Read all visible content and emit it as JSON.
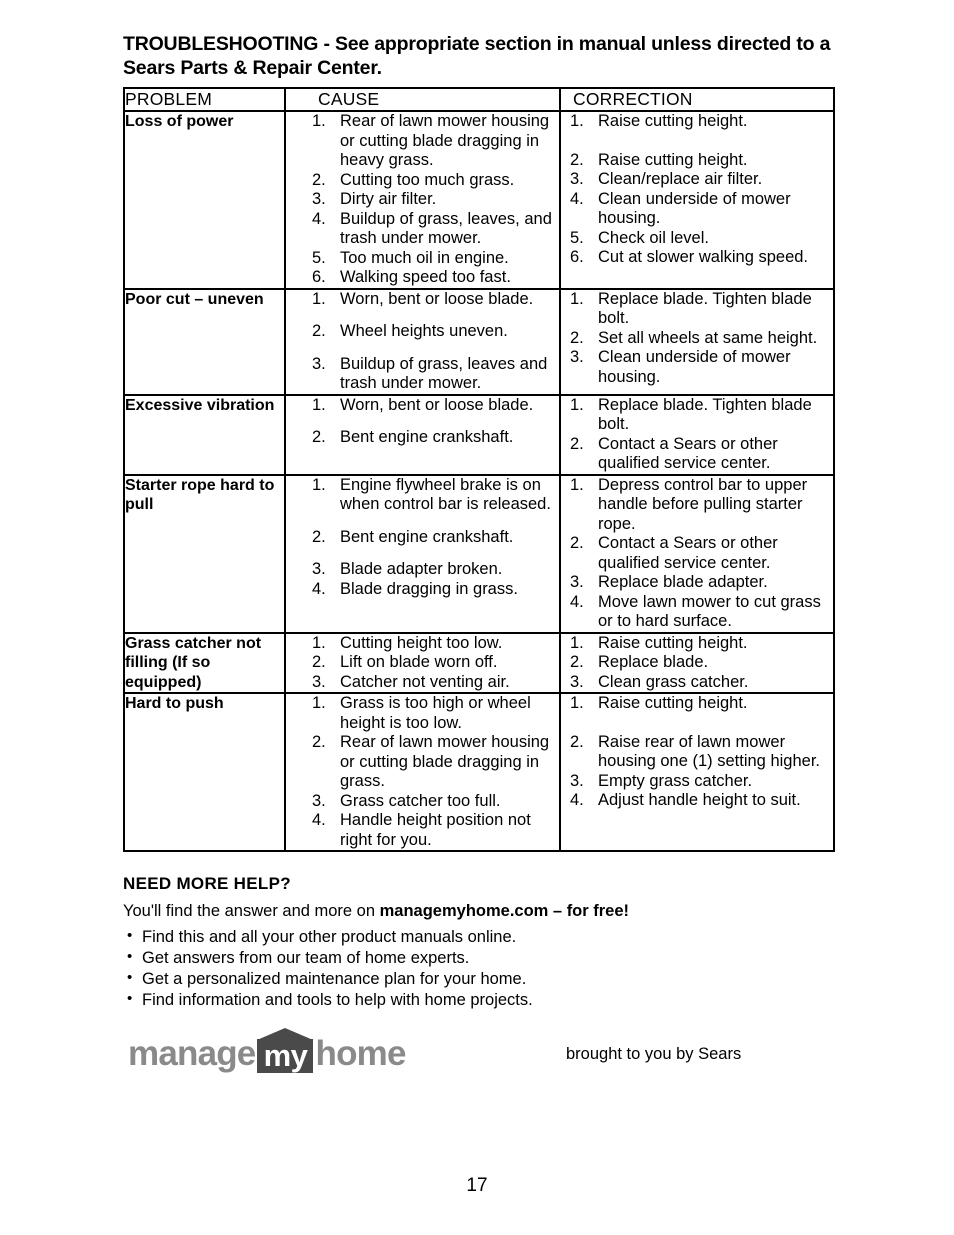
{
  "document": {
    "heading": "TROUBLESHOOTING - See appropriate section in manual unless directed to a Sears Parts & Repair Center.",
    "page_number": "17"
  },
  "table": {
    "headers": {
      "problem": "PROBLEM",
      "cause": "CAUSE",
      "correction": "CORRECTION"
    },
    "rows": [
      {
        "problem": "Loss of power",
        "causes": [
          "Rear of lawn mower housing or cutting blade dragging in heavy grass.",
          "Cutting too much grass.",
          "Dirty air filter.",
          "Buildup of grass, leaves, and trash under mower.",
          "Too much oil in engine.",
          "Walking speed too fast."
        ],
        "corrections": [
          "Raise cutting height.",
          "Raise cutting height.",
          "Clean/replace air filter.",
          "Clean underside of mower housing.",
          "Check oil level.",
          "Cut at slower walking speed."
        ]
      },
      {
        "problem": "Poor cut – uneven",
        "causes": [
          "Worn, bent or loose blade.",
          "Wheel heights uneven.",
          "Buildup of grass, leaves and trash under mower."
        ],
        "corrections": [
          "Replace blade. Tighten blade bolt.",
          "Set all wheels at same height.",
          "Clean underside of mower housing."
        ]
      },
      {
        "problem": "Excessive vibration",
        "causes": [
          "Worn, bent or loose blade.",
          "Bent engine crankshaft."
        ],
        "corrections": [
          "Replace blade. Tighten blade bolt.",
          "Contact a Sears or other qualified service center."
        ]
      },
      {
        "problem": "Starter rope hard to pull",
        "causes": [
          "Engine flywheel brake is on when control bar is released.",
          "Bent engine crankshaft.",
          "Blade adapter broken.",
          "Blade dragging in grass."
        ],
        "corrections": [
          "Depress control bar to upper handle before pulling starter rope.",
          "Contact a Sears or other qualified service center.",
          "Replace blade adapter.",
          "Move lawn mower to cut grass or to hard surface."
        ]
      },
      {
        "problem": "Grass catcher not filling (If so equipped)",
        "causes": [
          "Cutting height too low.",
          "Lift on blade worn off.",
          "Catcher not venting air."
        ],
        "corrections": [
          "Raise cutting height.",
          "Replace blade.",
          "Clean grass catcher."
        ]
      },
      {
        "problem": "Hard to push",
        "causes": [
          "Grass is too high or wheel height is too low.",
          "Rear of lawn mower housing or cutting blade dragging in grass.",
          "Grass catcher too full.",
          "Handle height position not right for you."
        ],
        "corrections": [
          "Raise cutting height.",
          "Raise rear of lawn mower housing one (1) setting higher.",
          "Empty grass catcher.",
          "Adjust handle height to suit."
        ]
      }
    ]
  },
  "help": {
    "title": "NEED MORE HELP?",
    "lead_prefix": "You'll find the answer and more on ",
    "lead_bold": "managemyhome.com – for free!",
    "bullets": [
      "Find this and all your other product manuals online.",
      "Get answers from our team of home experts.",
      "Get a personalized maintenance plan for your home.",
      "Find information and tools to help with home projects."
    ],
    "bullet_glyph": "•"
  },
  "logo": {
    "word1": "manage",
    "badge": "my",
    "word2": "home",
    "tagline": "brought to you by Sears"
  }
}
